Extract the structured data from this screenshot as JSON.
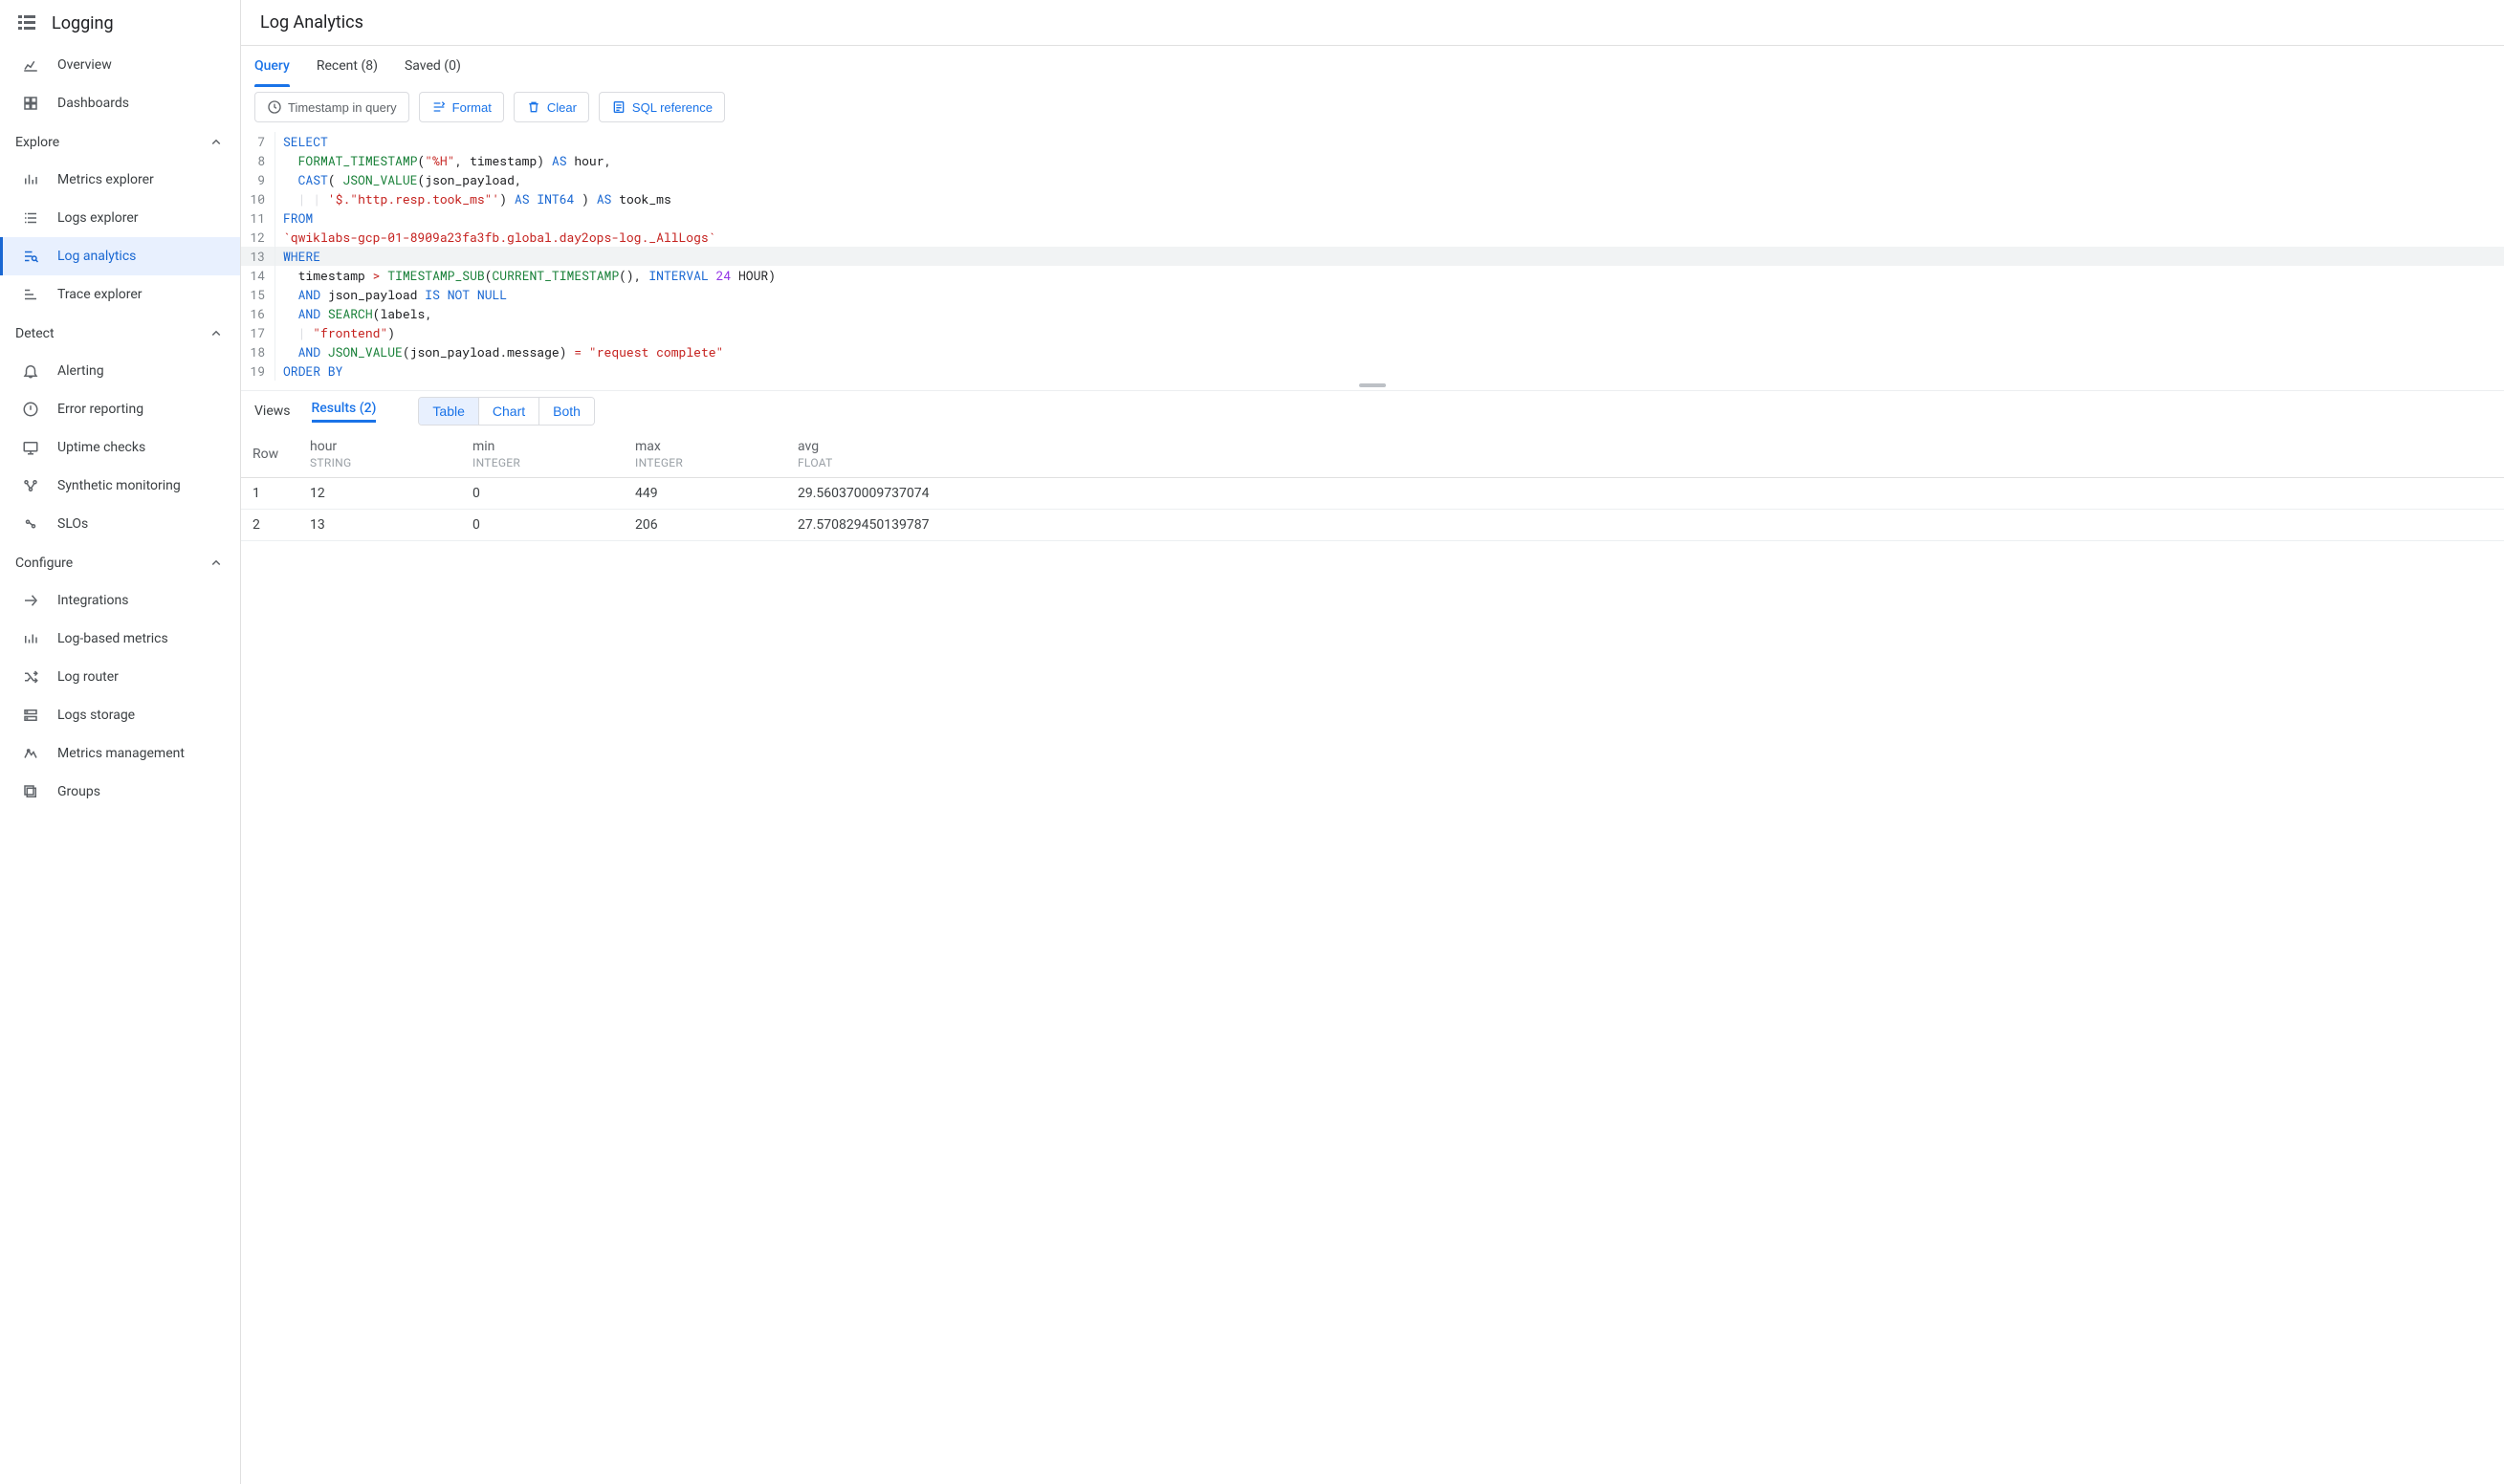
{
  "product": {
    "name": "Logging"
  },
  "sidebar": {
    "top": [
      {
        "label": "Overview",
        "icon": "stats"
      },
      {
        "label": "Dashboards",
        "icon": "dashboard"
      }
    ],
    "groups": [
      {
        "title": "Explore",
        "items": [
          {
            "label": "Metrics explorer",
            "icon": "bars"
          },
          {
            "label": "Logs explorer",
            "icon": "list"
          },
          {
            "label": "Log analytics",
            "icon": "search-list",
            "active": true
          },
          {
            "label": "Trace explorer",
            "icon": "trace"
          }
        ]
      },
      {
        "title": "Detect",
        "items": [
          {
            "label": "Alerting",
            "icon": "bell"
          },
          {
            "label": "Error reporting",
            "icon": "error"
          },
          {
            "label": "Uptime checks",
            "icon": "monitor"
          },
          {
            "label": "Synthetic monitoring",
            "icon": "nodes"
          },
          {
            "label": "SLOs",
            "icon": "gauge"
          }
        ]
      },
      {
        "title": "Configure",
        "items": [
          {
            "label": "Integrations",
            "icon": "integrate"
          },
          {
            "label": "Log-based metrics",
            "icon": "bars2"
          },
          {
            "label": "Log router",
            "icon": "shuffle"
          },
          {
            "label": "Logs storage",
            "icon": "storage"
          },
          {
            "label": "Metrics management",
            "icon": "tune"
          },
          {
            "label": "Groups",
            "icon": "copy"
          }
        ]
      }
    ]
  },
  "page": {
    "title": "Log Analytics"
  },
  "tabs": {
    "query": "Query",
    "recent": "Recent (8)",
    "saved": "Saved (0)"
  },
  "toolbar": {
    "timestamp": "Timestamp in query",
    "format": "Format",
    "clear": "Clear",
    "sqlref": "SQL reference"
  },
  "editor_start_line": 7,
  "results_bar": {
    "views": "Views",
    "results": "Results (2)",
    "table": "Table",
    "chart": "Chart",
    "both": "Both"
  },
  "table": {
    "columns": [
      {
        "name": "Row",
        "type": ""
      },
      {
        "name": "hour",
        "type": "STRING"
      },
      {
        "name": "min",
        "type": "INTEGER"
      },
      {
        "name": "max",
        "type": "INTEGER"
      },
      {
        "name": "avg",
        "type": "FLOAT"
      }
    ],
    "rows": [
      {
        "row": "1",
        "hour": "12",
        "min": "0",
        "max": "449",
        "avg": "29.560370009737074"
      },
      {
        "row": "2",
        "hour": "13",
        "min": "0",
        "max": "206",
        "avg": "27.570829450139787"
      }
    ]
  }
}
